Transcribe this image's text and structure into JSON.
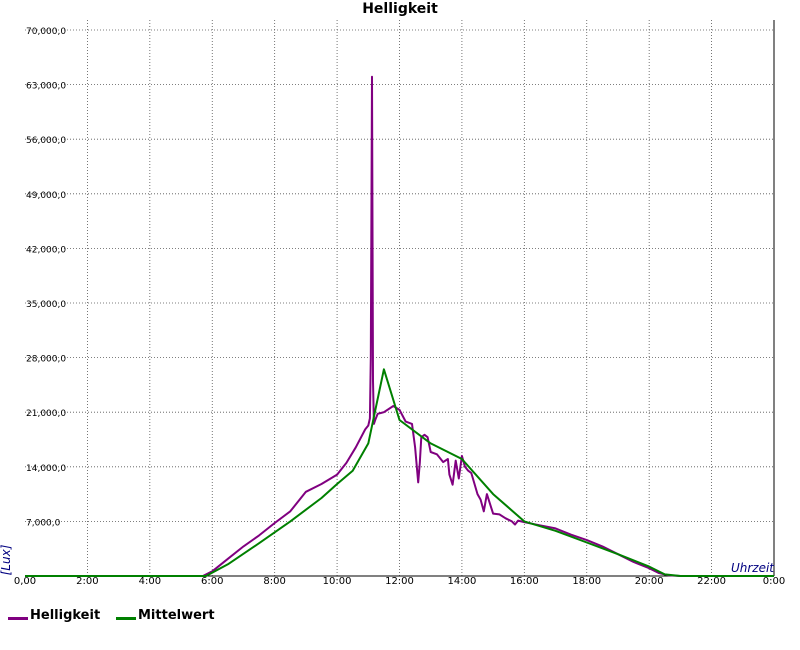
{
  "chart_data": {
    "type": "line",
    "title": "Helligkeit",
    "xlabel": "Uhrzeit",
    "ylabel": "[Lux]",
    "xlim": [
      0,
      24
    ],
    "ylim": [
      0,
      70000
    ],
    "grid": true,
    "legend_position": "bottom-left",
    "x_ticks": [
      {
        "value": 0,
        "label": "0,00"
      },
      {
        "value": 2,
        "label": "2:00"
      },
      {
        "value": 4,
        "label": "4:00"
      },
      {
        "value": 6,
        "label": "6:00"
      },
      {
        "value": 8,
        "label": "8:00"
      },
      {
        "value": 10,
        "label": "10:00"
      },
      {
        "value": 12,
        "label": "12:00"
      },
      {
        "value": 14,
        "label": "14:00"
      },
      {
        "value": 16,
        "label": "16:00"
      },
      {
        "value": 18,
        "label": "18:00"
      },
      {
        "value": 20,
        "label": "20:00"
      },
      {
        "value": 22,
        "label": "22:00"
      },
      {
        "value": 24,
        "label": "0:00"
      }
    ],
    "y_ticks": [
      {
        "value": 7000,
        "label": "7,000,0"
      },
      {
        "value": 14000,
        "label": "14,000,0"
      },
      {
        "value": 21000,
        "label": "21,000,0"
      },
      {
        "value": 28000,
        "label": "28,000,0"
      },
      {
        "value": 35000,
        "label": "35,000,0"
      },
      {
        "value": 42000,
        "label": "42,000,0"
      },
      {
        "value": 49000,
        "label": "49,000,0"
      },
      {
        "value": 56000,
        "label": "56,000,0"
      },
      {
        "value": 63000,
        "label": "63,000,0"
      },
      {
        "value": 70000,
        "label": "70,000,0"
      }
    ],
    "series": [
      {
        "name": "Helligkeit",
        "color": "#800080",
        "x": [
          0,
          5.7,
          6.0,
          6.5,
          7.0,
          7.5,
          8.0,
          8.5,
          9.0,
          9.5,
          10.0,
          10.3,
          10.6,
          10.9,
          11.0,
          11.05,
          11.08,
          11.12,
          11.15,
          11.18,
          11.22,
          11.3,
          11.5,
          11.8,
          12.0,
          12.2,
          12.4,
          12.5,
          12.6,
          12.65,
          12.7,
          12.8,
          12.9,
          13.0,
          13.2,
          13.4,
          13.55,
          13.6,
          13.7,
          13.8,
          13.9,
          14.0,
          14.1,
          14.2,
          14.3,
          14.5,
          14.6,
          14.7,
          14.8,
          15.0,
          15.2,
          15.4,
          15.6,
          15.7,
          15.8,
          16.0,
          16.5,
          17.0,
          17.5,
          18.0,
          18.5,
          19.0,
          19.5,
          20.0,
          20.3,
          20.6,
          21.0,
          24
        ],
        "y": [
          0,
          0,
          600,
          2200,
          3800,
          5200,
          6800,
          8300,
          10800,
          11800,
          13000,
          14500,
          16500,
          18800,
          19300,
          20200,
          28000,
          64000,
          25000,
          19500,
          20000,
          20800,
          21000,
          21800,
          21300,
          19800,
          19500,
          16500,
          12000,
          14500,
          17800,
          18100,
          17800,
          15900,
          15600,
          14600,
          15000,
          13000,
          11700,
          14800,
          12500,
          15400,
          14000,
          13500,
          13200,
          10500,
          9800,
          8300,
          10500,
          8000,
          7900,
          7400,
          7000,
          6600,
          7100,
          6900,
          6500,
          6100,
          5300,
          4600,
          3800,
          2800,
          1800,
          1000,
          400,
          100,
          0,
          0
        ]
      },
      {
        "name": "Mittelwert",
        "color": "#008000",
        "x": [
          0,
          5.8,
          6.5,
          7.5,
          8.5,
          9.5,
          10.0,
          10.5,
          11.0,
          11.5,
          12.0,
          13.0,
          14.0,
          15.0,
          16.0,
          17.0,
          18.0,
          19.0,
          20.0,
          20.5,
          21.0,
          24
        ],
        "y": [
          0,
          0,
          1500,
          4200,
          7000,
          10000,
          11800,
          13500,
          17000,
          26500,
          20000,
          17000,
          15000,
          10500,
          7000,
          5800,
          4300,
          2800,
          1200,
          200,
          0,
          0
        ]
      }
    ]
  }
}
